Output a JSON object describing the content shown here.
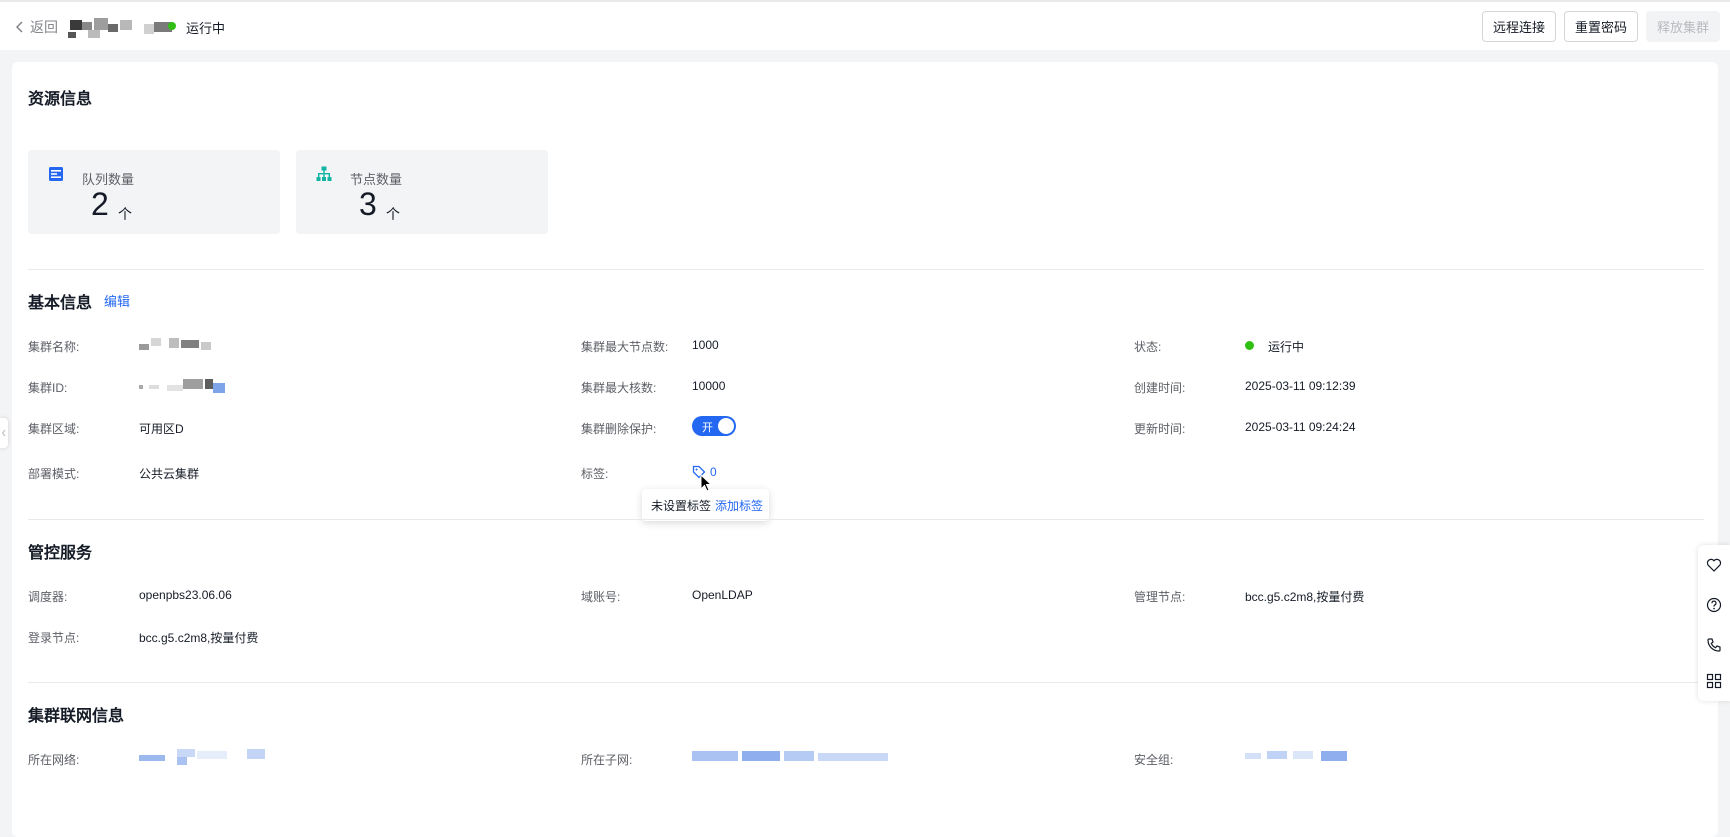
{
  "header": {
    "back_label": "返回",
    "status": "运行中",
    "buttons": {
      "remote": "远程连接",
      "reset": "重置密码",
      "release": "释放集群"
    }
  },
  "resource": {
    "title": "资源信息",
    "queue": {
      "label": "队列数量",
      "value": "2",
      "unit": "个"
    },
    "node": {
      "label": "节点数量",
      "value": "3",
      "unit": "个"
    }
  },
  "basic": {
    "title": "基本信息",
    "edit": "编辑",
    "cluster_name_label": "集群名称:",
    "cluster_id_label": "集群ID:",
    "region_label": "集群区域:",
    "region_value": "可用区D",
    "deploy_label": "部署模式:",
    "deploy_value": "公共云集群",
    "max_nodes_label": "集群最大节点数:",
    "max_nodes_value": "1000",
    "max_cores_label": "集群最大核数:",
    "max_cores_value": "10000",
    "protect_label": "集群删除保护:",
    "protect_value": "开",
    "tags_label": "标签:",
    "tags_value": "0",
    "state_label": "状态:",
    "state_value": "运行中",
    "created_label": "创建时间:",
    "created_value": "2025-03-11 09:12:39",
    "updated_label": "更新时间:",
    "updated_value": "2025-03-11 09:24:24"
  },
  "tooltip": {
    "text": "未设置标签",
    "add": "添加标签"
  },
  "control": {
    "title": "管控服务",
    "scheduler_label": "调度器:",
    "scheduler_value": "openpbs23.06.06",
    "domain_label": "域账号:",
    "domain_value": "OpenLDAP",
    "mgmt_label": "管理节点:",
    "mgmt_value": "bcc.g5.c2m8,按量付费",
    "login_label": "登录节点:",
    "login_value": "bcc.g5.c2m8,按量付费"
  },
  "network": {
    "title": "集群联网信息",
    "vpc_label": "所在网络:",
    "subnet_label": "所在子网:",
    "sg_label": "安全组:"
  },
  "colors": {
    "primary": "#2468f2",
    "success": "#30bf13",
    "text": "#151b26",
    "label": "#5c5f66",
    "background": "#f3f4f6"
  }
}
